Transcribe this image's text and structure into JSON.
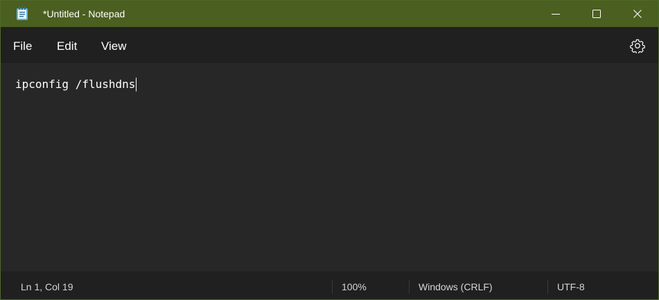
{
  "window": {
    "title": "*Untitled - Notepad",
    "app_icon": "notepad-icon",
    "controls": {
      "minimize_icon": "minimize-icon",
      "maximize_icon": "maximize-icon",
      "close_icon": "close-icon"
    }
  },
  "menu": {
    "items": [
      {
        "label": "File"
      },
      {
        "label": "Edit"
      },
      {
        "label": "View"
      }
    ],
    "settings_icon": "gear-icon"
  },
  "editor": {
    "content": "ipconfig /flushdns"
  },
  "status": {
    "position": "Ln 1, Col 19",
    "zoom": "100%",
    "line_ending": "Windows (CRLF)",
    "encoding": "UTF-8"
  },
  "colors": {
    "titlebar": "#4b5f20",
    "menubar": "#202020",
    "editor_bg": "#272727",
    "text": "#ffffff"
  }
}
